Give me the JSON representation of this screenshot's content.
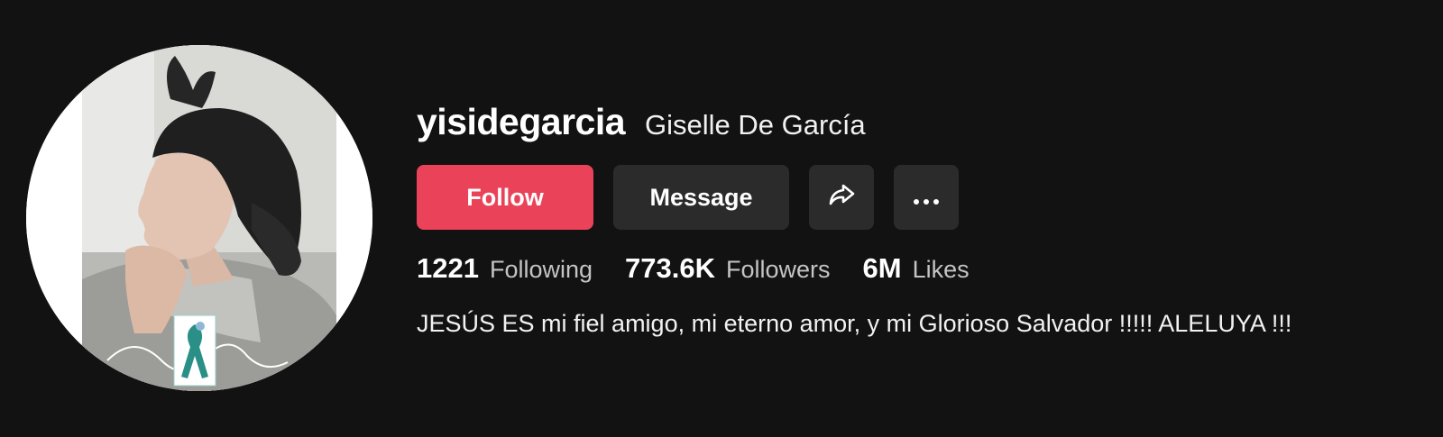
{
  "profile": {
    "username": "yisidegarcia",
    "nickname": "Giselle De García",
    "bio": "JESÚS ES mi fiel amigo, mi eterno amor, y mi Glorioso Salvador !!!!! ALELUYA !!!",
    "avatar_icons": [
      "awareness-ribbon-icon"
    ]
  },
  "actions": {
    "follow_label": "Follow",
    "message_label": "Message",
    "share_icon": "share-icon",
    "more_icon": "more-icon"
  },
  "stats": {
    "following": {
      "count": "1221",
      "label": "Following"
    },
    "followers": {
      "count": "773.6K",
      "label": "Followers"
    },
    "likes": {
      "count": "6M",
      "label": "Likes"
    }
  },
  "colors": {
    "background": "#121212",
    "follow_button": "#ea4359",
    "secondary_button": "#2b2b2b",
    "stat_label": "#c4c4c4"
  }
}
